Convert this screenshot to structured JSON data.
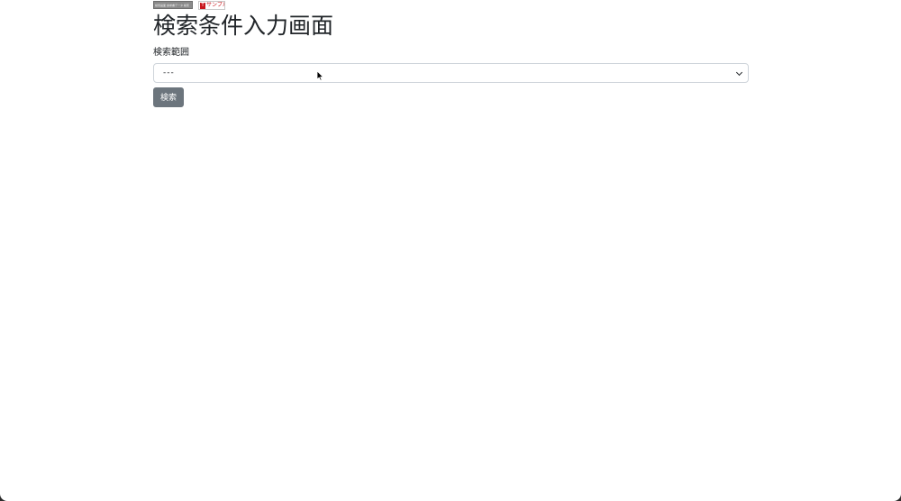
{
  "banner": {
    "left_text": "検索画面 請求書データ 検索",
    "right_mark": "T",
    "right_text": "サンプル"
  },
  "page": {
    "title": "検索条件入力画面"
  },
  "form": {
    "scope_label": "検索範囲",
    "scope_selected": "---",
    "search_button": "検索"
  },
  "icons": {
    "select_arrow": "chevron-down-icon",
    "cursor": "mouse-pointer-icon"
  },
  "colors": {
    "button_bg": "#6c757d",
    "banner_accent": "#c8161d",
    "border": "#ced4da"
  }
}
